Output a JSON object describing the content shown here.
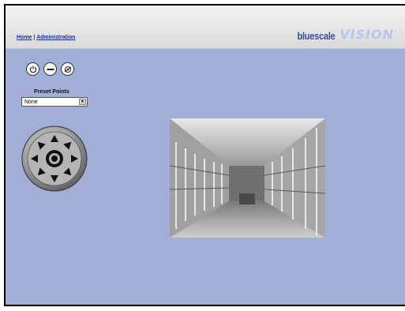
{
  "header": {
    "breadcrumb": {
      "home": "Home",
      "separator": "|",
      "admin": "Administration"
    },
    "logo": {
      "brand": "bluescale",
      "product": "VISION"
    }
  },
  "controls": {
    "buttons": [
      {
        "name": "power-icon"
      },
      {
        "name": "minus-icon"
      },
      {
        "name": "settings-icon"
      }
    ],
    "preset_label": "Preset Points",
    "preset_value": "None"
  },
  "ptz": {
    "directions": [
      "up",
      "up-right",
      "right",
      "down-right",
      "down",
      "down-left",
      "left",
      "up-left"
    ]
  },
  "colors": {
    "background": "#a3aed6",
    "link": "#1c2f9a"
  }
}
